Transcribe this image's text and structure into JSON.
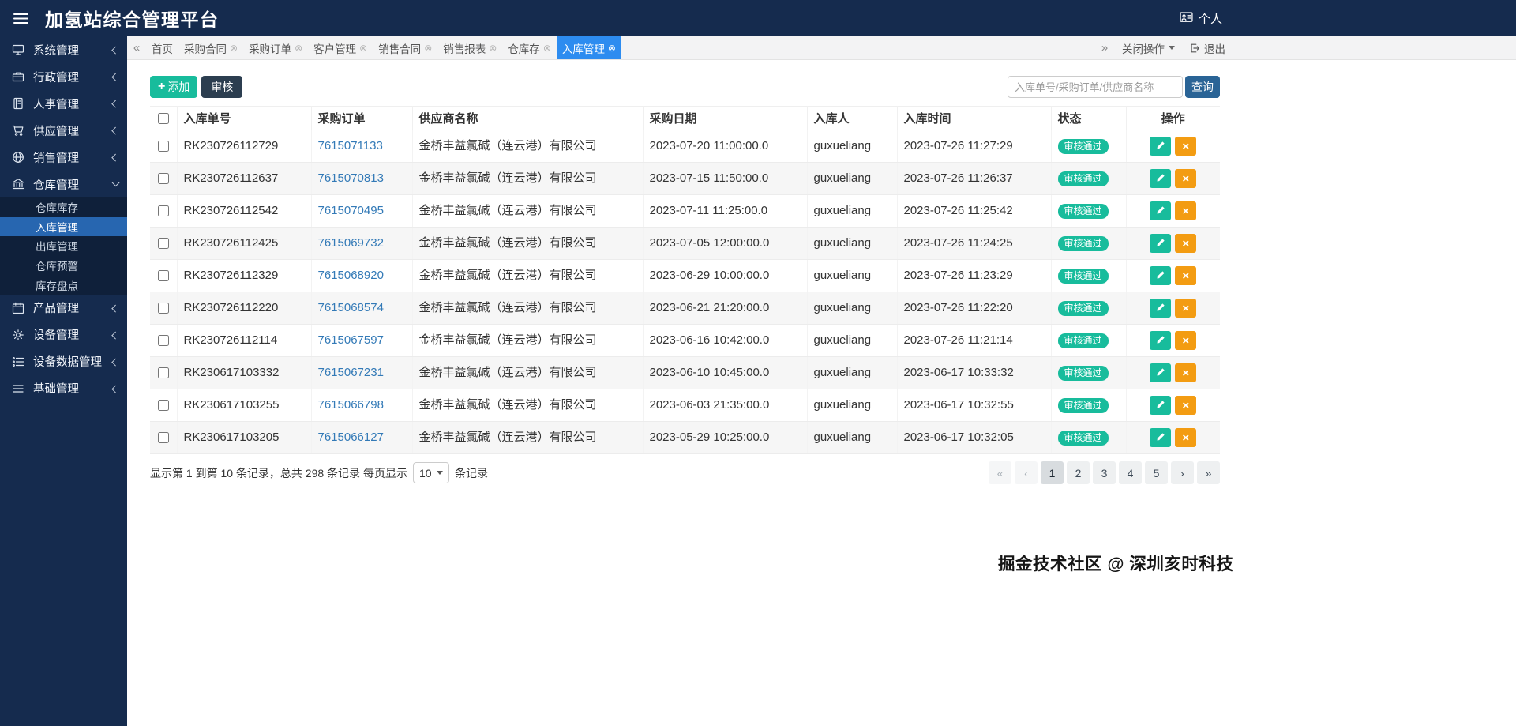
{
  "app": {
    "title": "加氢站综合管理平台",
    "user_label": "个人"
  },
  "icons": {
    "plus_glyph": "+",
    "tab_close_glyph": "⊗",
    "delete_glyph": "×"
  },
  "colors": {
    "navy": "#152b4e",
    "navy_dark": "#0f2240",
    "sub_active": "#2766b0",
    "tab_active": "#2d8cf0",
    "teal": "#18bc9c",
    "btn_dark": "#2c3e50",
    "query": "#2a6496",
    "orange": "#f39c12",
    "link": "#337ab7"
  },
  "sidebar": {
    "items": [
      {
        "label": "系统管理",
        "icon": "desktop-icon"
      },
      {
        "label": "行政管理",
        "icon": "briefcase-icon"
      },
      {
        "label": "人事管理",
        "icon": "address-book-icon"
      },
      {
        "label": "供应管理",
        "icon": "cart-icon"
      },
      {
        "label": "销售管理",
        "icon": "globe-icon"
      },
      {
        "label": "仓库管理",
        "icon": "bank-icon",
        "expanded": true,
        "children": [
          {
            "label": "仓库库存"
          },
          {
            "label": "入库管理",
            "active": true
          },
          {
            "label": "出库管理"
          },
          {
            "label": "仓库预警"
          },
          {
            "label": "库存盘点"
          }
        ]
      },
      {
        "label": "产品管理",
        "icon": "calendar-icon"
      },
      {
        "label": "设备管理",
        "icon": "gear-icon"
      },
      {
        "label": "设备数据管理",
        "icon": "list-icon"
      },
      {
        "label": "基础管理",
        "icon": "menu-icon"
      }
    ]
  },
  "tabbar": {
    "scroll_left": "«",
    "scroll_right": "»",
    "tabs": [
      {
        "label": "首页",
        "closable": false
      },
      {
        "label": "采购合同",
        "closable": true
      },
      {
        "label": "采购订单",
        "closable": true
      },
      {
        "label": "客户管理",
        "closable": true
      },
      {
        "label": "销售合同",
        "closable": true
      },
      {
        "label": "销售报表",
        "closable": true
      },
      {
        "label": "仓库存",
        "closable": true
      },
      {
        "label": "入库管理",
        "closable": true,
        "active": true
      }
    ],
    "close_ops_label": "关闭操作",
    "exit_label": "退出"
  },
  "toolbar": {
    "add_label": "添加",
    "audit_label": "审核",
    "search_placeholder": "入库单号/采购订单/供应商名称",
    "search_label": "查询"
  },
  "table": {
    "columns": [
      "入库单号",
      "采购订单",
      "供应商名称",
      "采购日期",
      "入库人",
      "入库时间",
      "状态",
      "操作"
    ],
    "rows": [
      {
        "receipt_no": "RK230726112729",
        "order_no": "7615071133",
        "supplier": "金桥丰益氯碱（连云港）有限公司",
        "purchase_date": "2023-07-20 11:00:00.0",
        "operator": "guxueliang",
        "in_time": "2023-07-26 11:27:29",
        "status": "审核通过"
      },
      {
        "receipt_no": "RK230726112637",
        "order_no": "7615070813",
        "supplier": "金桥丰益氯碱（连云港）有限公司",
        "purchase_date": "2023-07-15 11:50:00.0",
        "operator": "guxueliang",
        "in_time": "2023-07-26 11:26:37",
        "status": "审核通过"
      },
      {
        "receipt_no": "RK230726112542",
        "order_no": "7615070495",
        "supplier": "金桥丰益氯碱（连云港）有限公司",
        "purchase_date": "2023-07-11 11:25:00.0",
        "operator": "guxueliang",
        "in_time": "2023-07-26 11:25:42",
        "status": "审核通过"
      },
      {
        "receipt_no": "RK230726112425",
        "order_no": "7615069732",
        "supplier": "金桥丰益氯碱（连云港）有限公司",
        "purchase_date": "2023-07-05 12:00:00.0",
        "operator": "guxueliang",
        "in_time": "2023-07-26 11:24:25",
        "status": "审核通过"
      },
      {
        "receipt_no": "RK230726112329",
        "order_no": "7615068920",
        "supplier": "金桥丰益氯碱（连云港）有限公司",
        "purchase_date": "2023-06-29 10:00:00.0",
        "operator": "guxueliang",
        "in_time": "2023-07-26 11:23:29",
        "status": "审核通过"
      },
      {
        "receipt_no": "RK230726112220",
        "order_no": "7615068574",
        "supplier": "金桥丰益氯碱（连云港）有限公司",
        "purchase_date": "2023-06-21 21:20:00.0",
        "operator": "guxueliang",
        "in_time": "2023-07-26 11:22:20",
        "status": "审核通过"
      },
      {
        "receipt_no": "RK230726112114",
        "order_no": "7615067597",
        "supplier": "金桥丰益氯碱（连云港）有限公司",
        "purchase_date": "2023-06-16 10:42:00.0",
        "operator": "guxueliang",
        "in_time": "2023-07-26 11:21:14",
        "status": "审核通过"
      },
      {
        "receipt_no": "RK230617103332",
        "order_no": "7615067231",
        "supplier": "金桥丰益氯碱（连云港）有限公司",
        "purchase_date": "2023-06-10 10:45:00.0",
        "operator": "guxueliang",
        "in_time": "2023-06-17 10:33:32",
        "status": "审核通过"
      },
      {
        "receipt_no": "RK230617103255",
        "order_no": "7615066798",
        "supplier": "金桥丰益氯碱（连云港）有限公司",
        "purchase_date": "2023-06-03 21:35:00.0",
        "operator": "guxueliang",
        "in_time": "2023-06-17 10:32:55",
        "status": "审核通过"
      },
      {
        "receipt_no": "RK230617103205",
        "order_no": "7615066127",
        "supplier": "金桥丰益氯碱（连云港）有限公司",
        "purchase_date": "2023-05-29 10:25:00.0",
        "operator": "guxueliang",
        "in_time": "2023-06-17 10:32:05",
        "status": "审核通过"
      }
    ]
  },
  "pagination": {
    "summary_prefix": "显示第 1 到第 10 条记录，总共 298 条记录 每页显示",
    "page_size": "10",
    "summary_suffix": "条记录",
    "items": [
      {
        "label": "«",
        "type": "first",
        "state": "disabled"
      },
      {
        "label": "‹",
        "type": "prev",
        "state": "disabled"
      },
      {
        "label": "1",
        "type": "page",
        "state": "active"
      },
      {
        "label": "2",
        "type": "page"
      },
      {
        "label": "3",
        "type": "page"
      },
      {
        "label": "4",
        "type": "page"
      },
      {
        "label": "5",
        "type": "page"
      },
      {
        "label": "›",
        "type": "next"
      },
      {
        "label": "»",
        "type": "last"
      }
    ]
  },
  "watermark": "掘金技术社区 @ 深圳亥时科技"
}
